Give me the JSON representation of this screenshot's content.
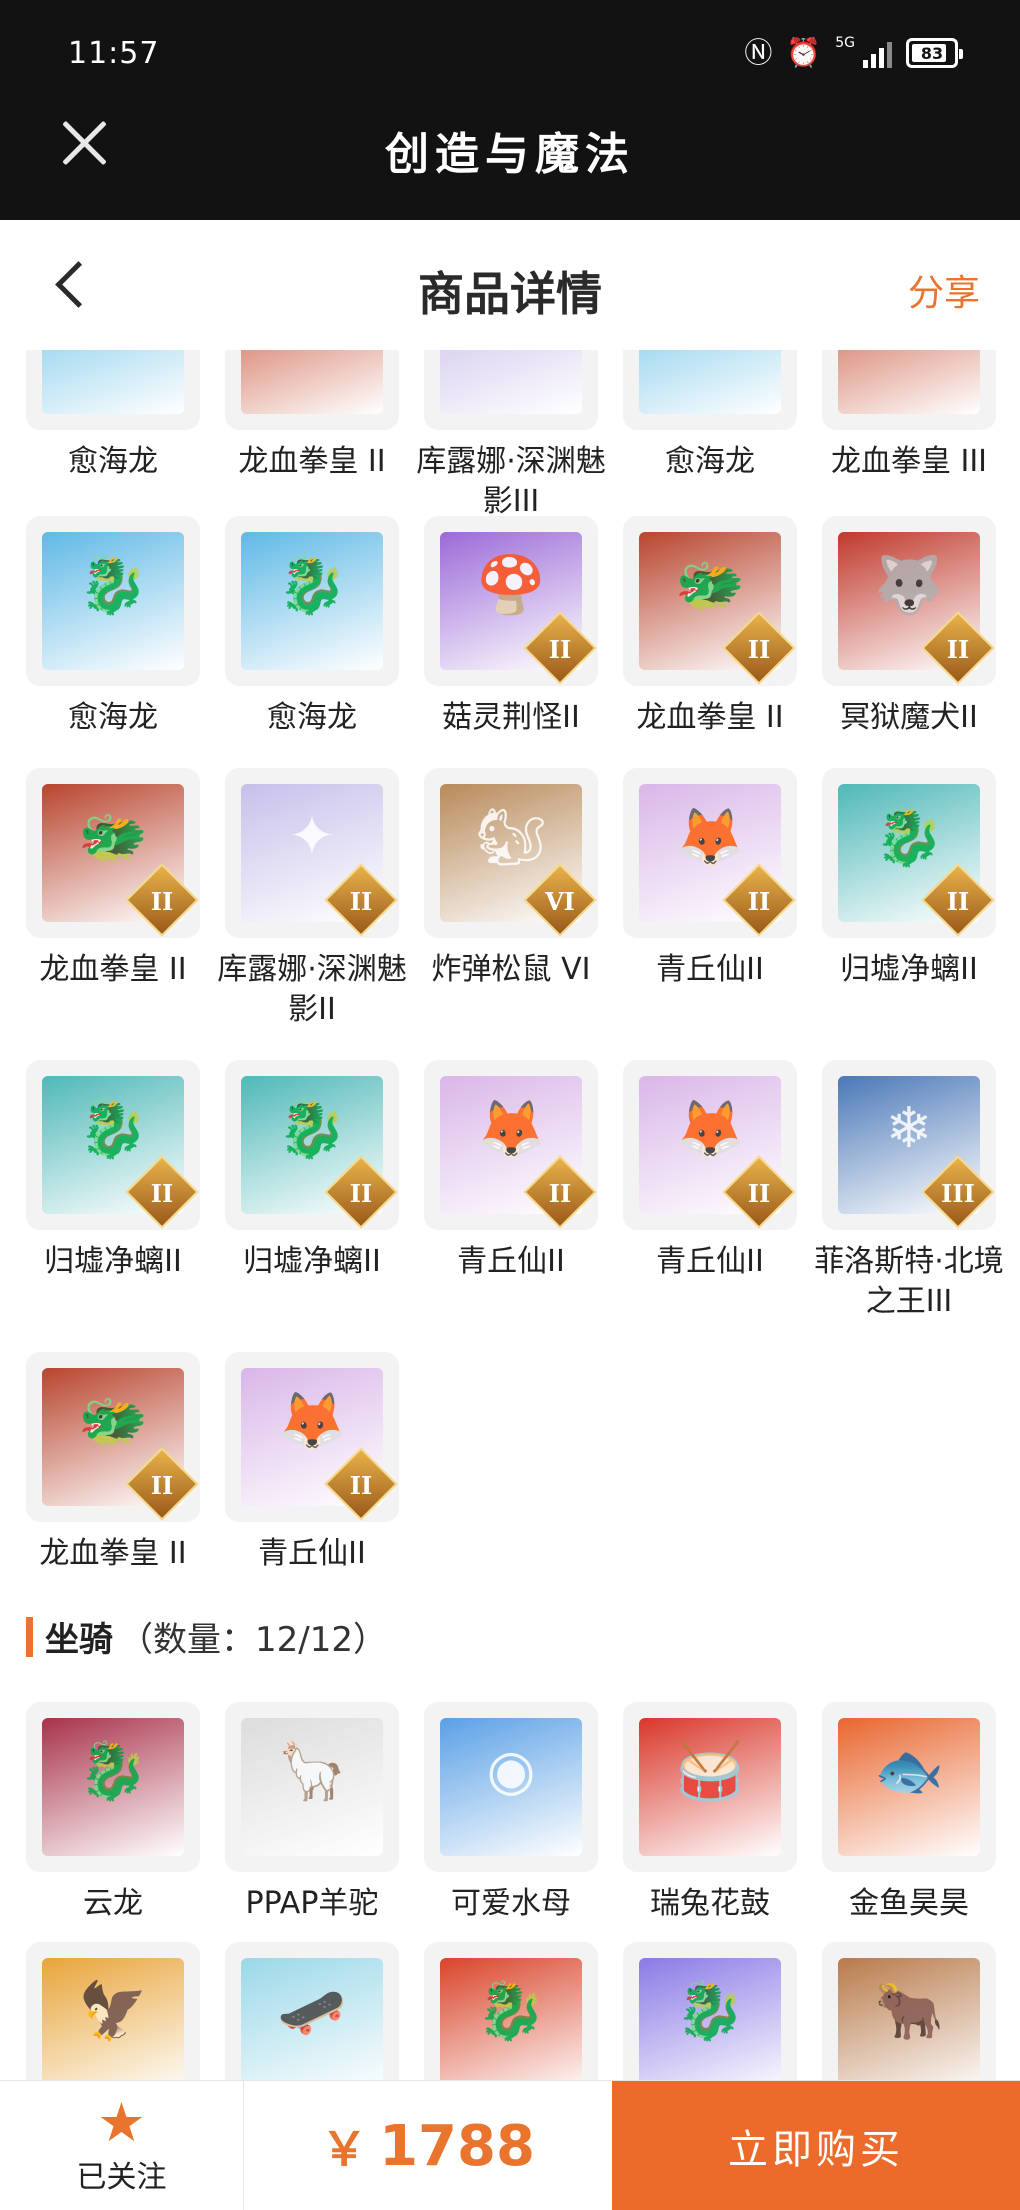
{
  "status": {
    "time": "11:57",
    "network": "5G",
    "battery": "83"
  },
  "app": {
    "title": "创造与魔法"
  },
  "header": {
    "title": "商品详情",
    "share_label": "分享"
  },
  "pets_partial_row": [
    {
      "name": "愈海龙",
      "color": "#6fc3e8"
    },
    {
      "name": "龙血拳皇 II",
      "color": "#c9553a"
    },
    {
      "name": "库露娜·深渊魅影III",
      "color": "#c6b8e8"
    },
    {
      "name": "愈海龙",
      "color": "#6fc3e8"
    },
    {
      "name": "龙血拳皇 III",
      "color": "#c9553a"
    }
  ],
  "pets": [
    {
      "name": "愈海龙",
      "color": "#5fb9e6",
      "glyph": "🐉",
      "rank": ""
    },
    {
      "name": "愈海龙",
      "color": "#5fb9e6",
      "glyph": "🐉",
      "rank": ""
    },
    {
      "name": "菇灵荆怪II",
      "color": "#9b6ad8",
      "glyph": "🍄",
      "rank": "II"
    },
    {
      "name": "龙血拳皇 II",
      "color": "#b8452e",
      "glyph": "🐲",
      "rank": "II"
    },
    {
      "name": "冥狱魔犬II",
      "color": "#c0392b",
      "glyph": "🐺",
      "rank": "II"
    },
    {
      "name": "龙血拳皇 II",
      "color": "#b8452e",
      "glyph": "🐲",
      "rank": "II"
    },
    {
      "name": "库露娜·深渊魅影II",
      "color": "#c6c0ea",
      "glyph": "✦",
      "rank": "II"
    },
    {
      "name": "炸弹松鼠 VI",
      "color": "#b88a5a",
      "glyph": "🐿",
      "rank": "VI"
    },
    {
      "name": "青丘仙II",
      "color": "#d9b6e8",
      "glyph": "🦊",
      "rank": "II"
    },
    {
      "name": "归墟净螭II",
      "color": "#4fb8b8",
      "glyph": "🐉",
      "rank": "II"
    },
    {
      "name": "归墟净螭II",
      "color": "#4fb8b8",
      "glyph": "🐉",
      "rank": "II"
    },
    {
      "name": "归墟净螭II",
      "color": "#4fb8b8",
      "glyph": "🐉",
      "rank": "II"
    },
    {
      "name": "青丘仙II",
      "color": "#d9b6e8",
      "glyph": "🦊",
      "rank": "II"
    },
    {
      "name": "青丘仙II",
      "color": "#d9b6e8",
      "glyph": "🦊",
      "rank": "II"
    },
    {
      "name": "菲洛斯特·北境之王III",
      "color": "#4a78b8",
      "glyph": "❄",
      "rank": "III"
    },
    {
      "name": "龙血拳皇 II",
      "color": "#b8452e",
      "glyph": "🐲",
      "rank": "II"
    },
    {
      "name": "青丘仙II",
      "color": "#d9b6e8",
      "glyph": "🦊",
      "rank": "II"
    }
  ],
  "mounts_section": {
    "title": "坐骑",
    "count_label": "（数量：12/12）"
  },
  "mounts": [
    {
      "name": "云龙",
      "color": "#a8324a",
      "glyph": "🐉"
    },
    {
      "name": "PPAP羊驼",
      "color": "#dcdcdc",
      "glyph": "🦙"
    },
    {
      "name": "可爱水母",
      "color": "#5aa0e6",
      "glyph": "◉"
    },
    {
      "name": "瑞兔花鼓",
      "color": "#d9372a",
      "glyph": "🥁"
    },
    {
      "name": "金鱼昊昊",
      "color": "#e8662e",
      "glyph": "🐟"
    }
  ],
  "mounts_partial_row": [
    {
      "color": "#e8a43a",
      "glyph": "🦅"
    },
    {
      "color": "#9ad8e8",
      "glyph": "🛹"
    },
    {
      "color": "#d9442a",
      "glyph": "🐉"
    },
    {
      "color": "#8a7ae6",
      "glyph": "🐉"
    },
    {
      "color": "#b87a4a",
      "glyph": "🐂"
    }
  ],
  "footer": {
    "follow_label": "已关注",
    "currency": "￥",
    "price": "1788",
    "buy_label": "立即购买"
  }
}
